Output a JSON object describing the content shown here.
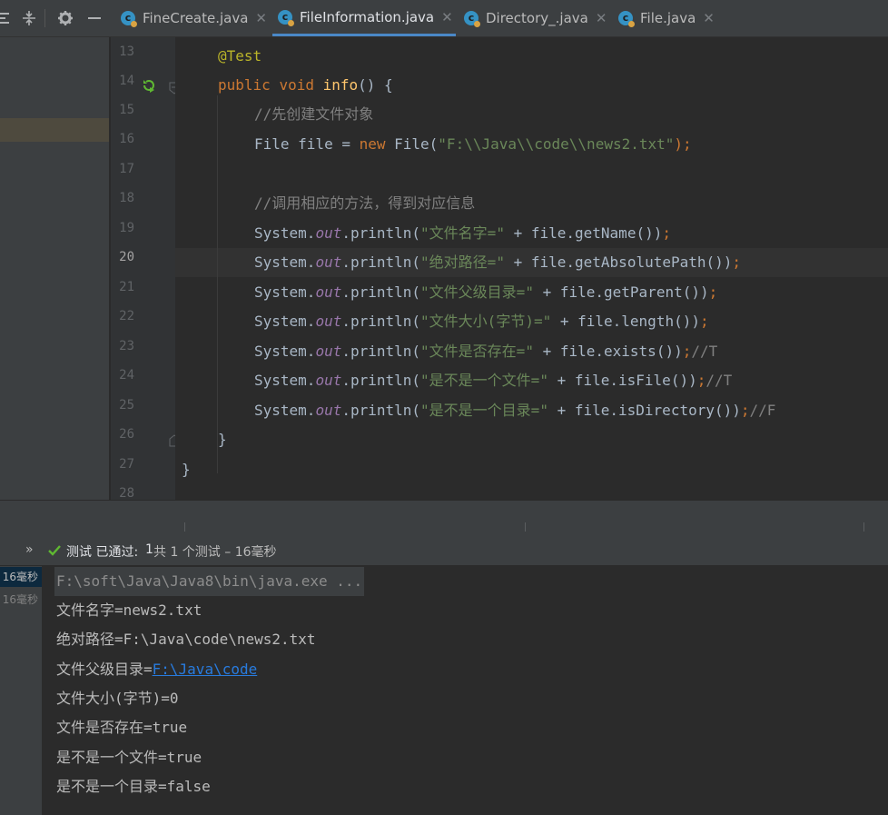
{
  "toolbar": {
    "icons": [
      "collapse-all-icon",
      "expand-all-icon",
      "gear-icon",
      "minimize-icon"
    ]
  },
  "tabs": [
    {
      "label": "FineCreate.java",
      "active": false
    },
    {
      "label": "FileInformation.java",
      "active": true
    },
    {
      "label": "Directory_.java",
      "active": false
    },
    {
      "label": "File.java",
      "active": false
    }
  ],
  "editor": {
    "line_numbers": [
      "13",
      "14",
      "15",
      "16",
      "17",
      "18",
      "19",
      "20",
      "21",
      "22",
      "23",
      "24",
      "25",
      "26",
      "27",
      "28"
    ],
    "current_line": "20",
    "code": {
      "annotation": "@Test",
      "method_kw1": "public",
      "method_kw2": "void",
      "method_name": "info",
      "method_tail": "() {",
      "comment1": "//先创建文件对象",
      "file_decl_a": "File file = ",
      "file_new": "new",
      "file_decl_b": " File(",
      "file_path": "\"F:\\\\Java\\\\code\\\\news2.txt\"",
      "file_decl_c": ");",
      "comment2": "//调用相应的方法，得到对应信息",
      "sys": "System.",
      "out": "out",
      "println": ".println(",
      "semi": ";",
      "println_lines": [
        {
          "str": "\"文件名字=\"",
          "rest": " + file.getName())",
          "comment": ""
        },
        {
          "str": "\"绝对路径=\"",
          "rest": " + file.getAbsolutePath())",
          "comment": ""
        },
        {
          "str": "\"文件父级目录=\"",
          "rest": " + file.getParent())",
          "comment": ""
        },
        {
          "str": "\"文件大小(字节)=\"",
          "rest": " + file.length())",
          "comment": ""
        },
        {
          "str": "\"文件是否存在=\"",
          "rest": " + file.exists())",
          "comment": "//T"
        },
        {
          "str": "\"是不是一个文件=\"",
          "rest": " + file.isFile())",
          "comment": "//T"
        },
        {
          "str": "\"是不是一个目录=\"",
          "rest": " + file.isDirectory())",
          "comment": "//F"
        }
      ],
      "close_method": "}",
      "close_class": "}"
    }
  },
  "run": {
    "expand": "»",
    "status": "测试 已通过:",
    "count": "1",
    "summary": "共 1 个测试 – 16毫秒",
    "times": [
      "16毫秒",
      "16毫秒"
    ],
    "console": {
      "command": "F:\\soft\\Java\\Java8\\bin\\java.exe ...",
      "lines": [
        "文件名字=news2.txt",
        "绝对路径=F:\\Java\\code\\news2.txt"
      ],
      "parent_label": "文件父级目录=",
      "parent_link": "F:\\Java\\code",
      "lines2": [
        "文件大小(字节)=0",
        "文件是否存在=true",
        "是不是一个文件=true",
        "是不是一个目录=false"
      ]
    }
  },
  "colors": {
    "accent": "#4a88c7",
    "pass": "#5fb832",
    "link": "#287bde"
  }
}
